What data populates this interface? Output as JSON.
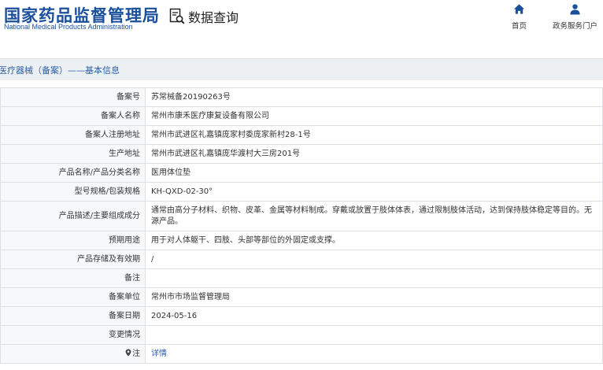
{
  "header": {
    "logo_cn": "国家药品监督管理局",
    "logo_en": "National Medical Products Administration",
    "query_label": "数据查询",
    "nav": [
      {
        "label": "首页",
        "icon": "home-icon"
      },
      {
        "label": "政务服务门户",
        "icon": "user-icon"
      }
    ]
  },
  "section_title": "医疗器械（备案）——基本信息",
  "rows": [
    {
      "label": "备案号",
      "value": "苏常械备20190263号"
    },
    {
      "label": "备案人名称",
      "value": "常州市康禾医疗康复设备有限公司"
    },
    {
      "label": "备案人注册地址",
      "value": "常州市武进区礼嘉镇庞家村委庞家新村28-1号"
    },
    {
      "label": "生产地址",
      "value": "常州市武进区礼嘉镇庞华渡村大三房201号"
    },
    {
      "label": "产品名称/产品分类名称",
      "value": "医用体位垫"
    },
    {
      "label": "型号规格/包装规格",
      "value": "KH-QXD-02-30°"
    },
    {
      "label": "产品描述/主要组成成分",
      "value": "通常由高分子材料、织物、皮革、金属等材料制成。穿戴或放置于肢体体表，通过限制肢体活动，达到保持肢体稳定等目的。无源产品。"
    },
    {
      "label": "预期用途",
      "value": "用于对人体躯干、四肢、头部等部位的外固定或支撑。"
    },
    {
      "label": "产品存储及有效期",
      "value": "/"
    },
    {
      "label": "备注",
      "value": ""
    },
    {
      "label": "备案单位",
      "value": "常州市市场监督管理局"
    },
    {
      "label": "备案日期",
      "value": "2024-05-16"
    },
    {
      "label": "变更情况",
      "value": ""
    },
    {
      "label": "注",
      "value": "详情"
    }
  ],
  "colors": {
    "brand_blue": "#1a4f9c",
    "link_blue": "#2a5ea6",
    "title_bar_bg": "#edf0f3",
    "label_bg": "#f7f8fa",
    "border": "#dde1e6"
  }
}
